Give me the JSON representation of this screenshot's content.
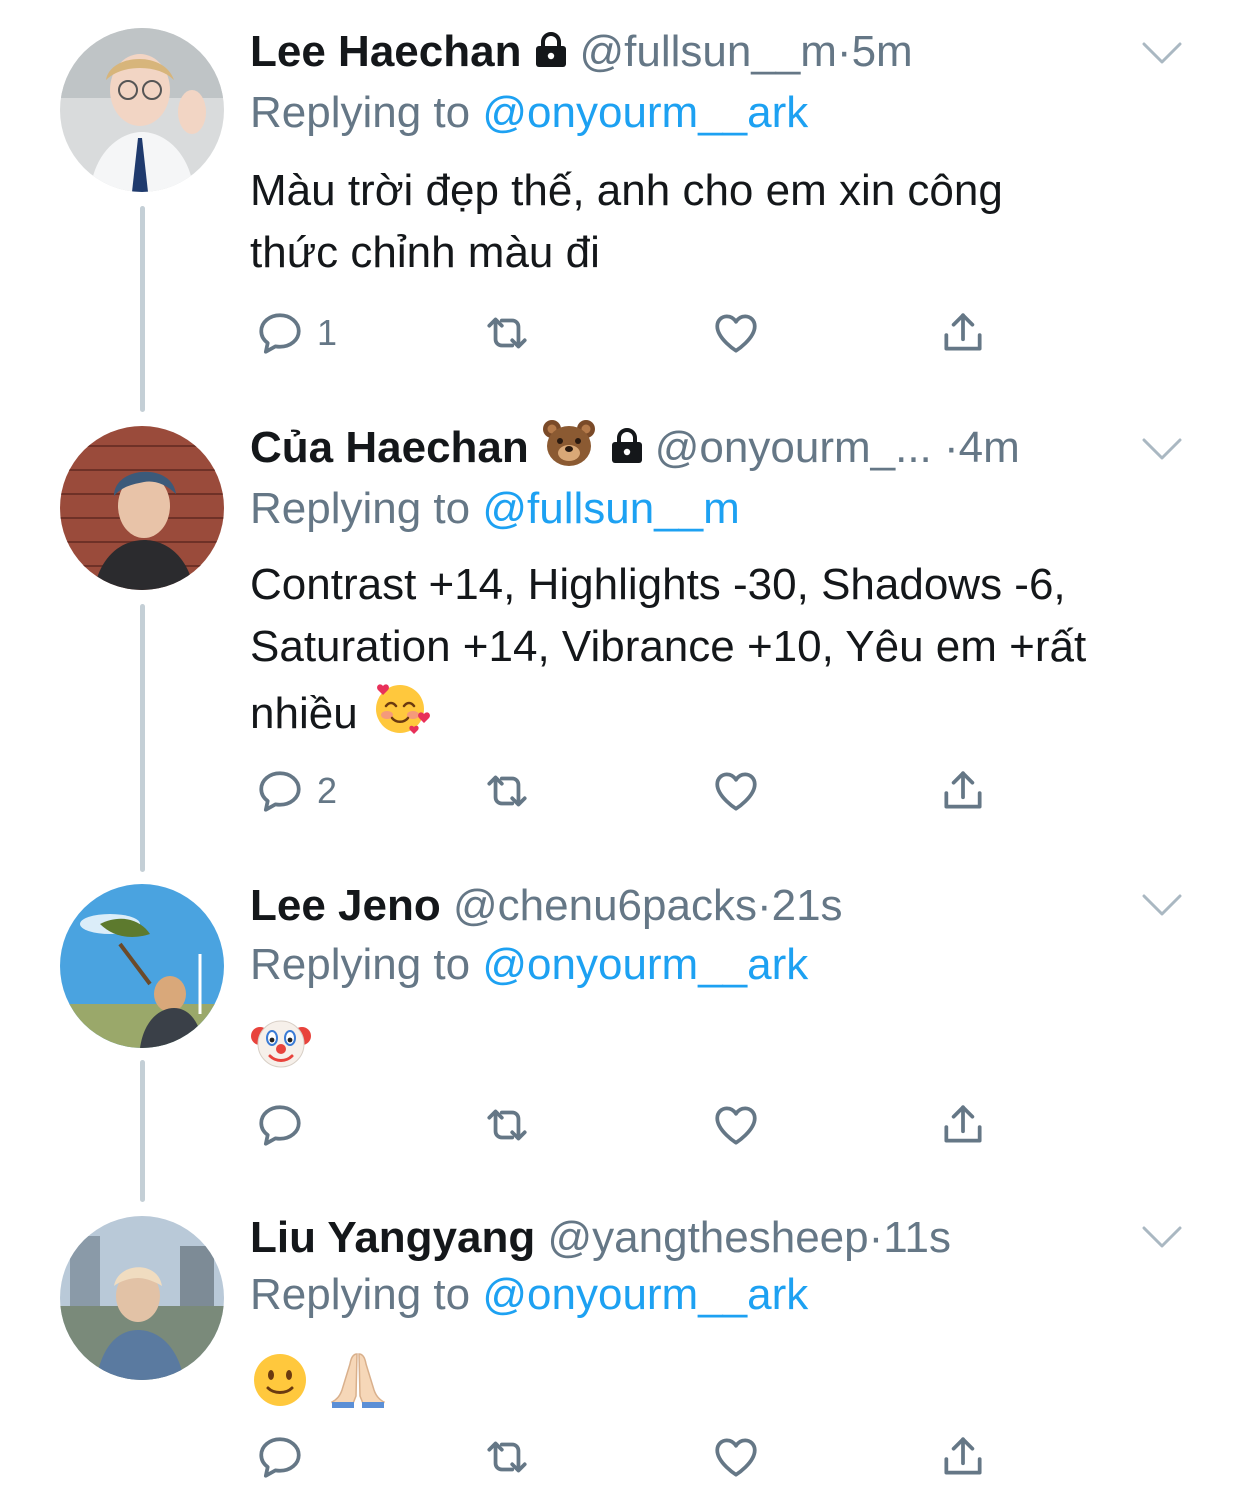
{
  "colors": {
    "link": "#1da1f2",
    "muted": "#657786",
    "text": "#14171a",
    "thread": "#c4cfd6"
  },
  "tweets": [
    {
      "name": "Lee Haechan",
      "locked": true,
      "handle": "@fullsun__m",
      "sep": "·",
      "time": "5m",
      "replying_prefix": "Replying to ",
      "replying_handle": "@onyourm__ark",
      "text_lines": [
        "Màu trời đẹp thế, anh cho em xin công",
        "thức chỉnh màu đi"
      ],
      "reply_count": "1",
      "avatar_icon": "avatar-photo"
    },
    {
      "name": "Của Haechan",
      "name_emoji": "bear-face",
      "locked": true,
      "handle": "@onyourm_...",
      "sep": "·",
      "time": "4m",
      "replying_prefix": "Replying to ",
      "replying_handle": "@fullsun__m",
      "text_lines": [
        "Contrast +14, Highlights -30, Shadows -6,",
        "Saturation +14, Vibrance +10, Yêu em +rất",
        "nhiều"
      ],
      "text_emoji": "smiling-face-with-hearts",
      "reply_count": "2",
      "avatar_icon": "avatar-photo"
    },
    {
      "name": "Lee Jeno",
      "handle": "@chenu6packs",
      "sep": "·",
      "time": "21s",
      "replying_prefix": "Replying to ",
      "replying_handle": "@onyourm__ark",
      "text_emoji": "clown-face",
      "reply_count": "",
      "avatar_icon": "avatar-photo"
    },
    {
      "name": "Liu Yangyang",
      "handle": "@yangthesheep",
      "sep": "·",
      "time": "11s",
      "replying_prefix": "Replying to ",
      "replying_handle": "@onyourm__ark",
      "text_emoji": "slightly-smiling-face folded-hands",
      "reply_count": "",
      "avatar_icon": "avatar-photo"
    }
  ]
}
